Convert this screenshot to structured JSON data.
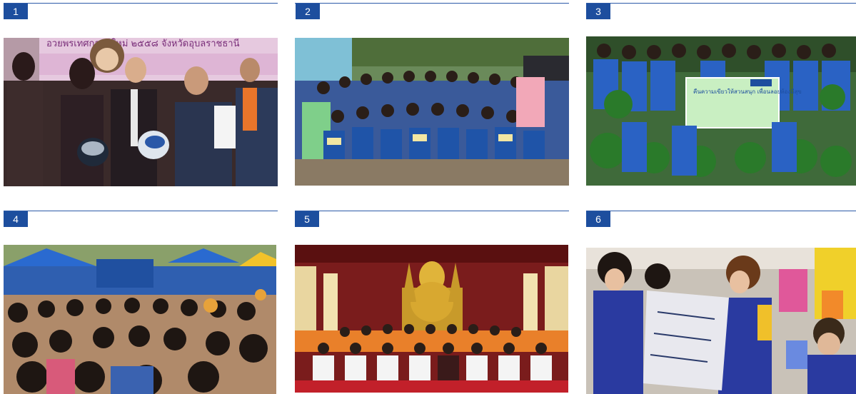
{
  "cells": [
    {
      "number": "1",
      "banner_text": "อวยพรเทศกาลปีใหม่ ๒๕๕๘ จังหวัดอุบลราชธานี"
    },
    {
      "number": "2"
    },
    {
      "number": "3",
      "sign_text": "คืนความเขียวให้สวนสนุก เพื่อนลอยห้องมีสุข"
    },
    {
      "number": "4"
    },
    {
      "number": "5"
    },
    {
      "number": "6"
    }
  ],
  "colors": {
    "accent": "#1d4e9e",
    "rule": "#2c5aa8"
  }
}
